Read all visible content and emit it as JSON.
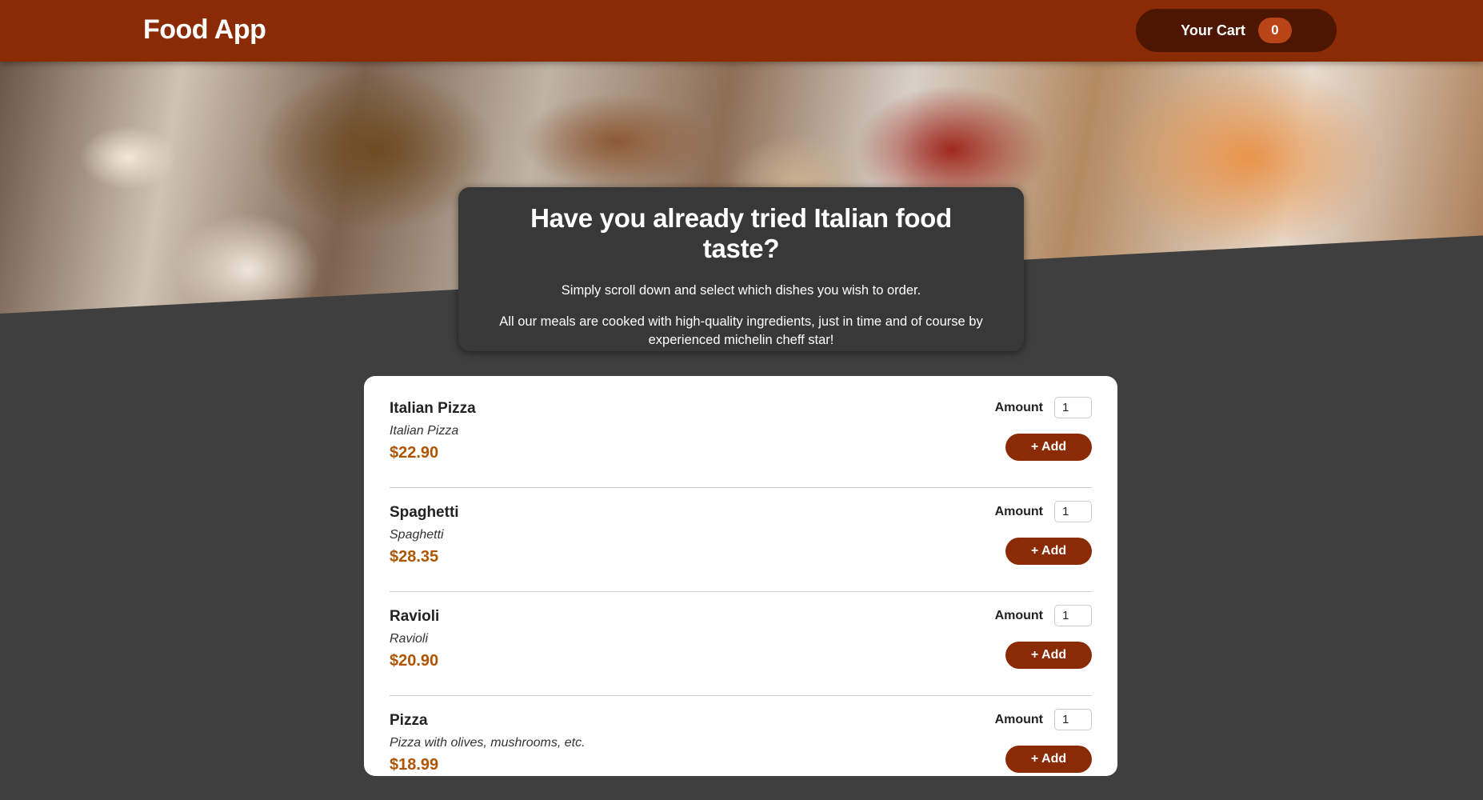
{
  "header": {
    "title": "Food App",
    "cart_label": "Your Cart",
    "cart_count": "0"
  },
  "hero": {
    "image": "banquet-table-food-image"
  },
  "summary": {
    "title": "Have you already tried Italian food taste?",
    "paragraph1": "Simply scroll down and select which dishes you wish to order.",
    "paragraph2": "All our meals are cooked with high-quality ingredients, just in time and of course by experienced michelin cheff star!"
  },
  "meals": [
    {
      "name": "Italian Pizza",
      "description": "Italian Pizza",
      "price": "$22.90",
      "amount_label": "Amount",
      "amount": "1",
      "add_label": "+ Add"
    },
    {
      "name": "Spaghetti",
      "description": "Spaghetti",
      "price": "$28.35",
      "amount_label": "Amount",
      "amount": "1",
      "add_label": "+ Add"
    },
    {
      "name": "Ravioli",
      "description": "Ravioli",
      "price": "$20.90",
      "amount_label": "Amount",
      "amount": "1",
      "add_label": "+ Add"
    },
    {
      "name": "Pizza",
      "description": "Pizza with olives, mushrooms, etc.",
      "price": "$18.99",
      "amount_label": "Amount",
      "amount": "1",
      "add_label": "+ Add"
    }
  ],
  "colors": {
    "header": "#8a2b06",
    "cart_button": "#4d1601",
    "cart_badge": "#b94517",
    "background": "#3f3f3f",
    "price": "#ad5502",
    "add_button": "#8a2b06"
  }
}
